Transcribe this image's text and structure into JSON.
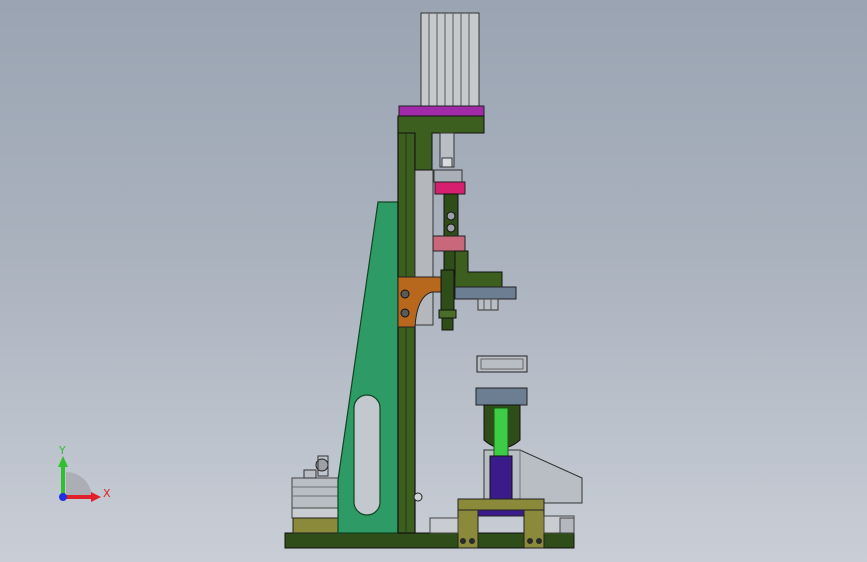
{
  "colors": {
    "background_top": "#9aa4b2",
    "background_bottom": "#c9ced6",
    "frame_dark_green": "#2f4d18",
    "frame_green": "#3c5e1f",
    "gusset_green": "#2e9a66",
    "motor_gray": "#c6cacd",
    "magenta_plate": "#a02aa8",
    "pink_block": "#d61f6e",
    "rose_block": "#c8687a",
    "orange_bracket": "#b8681d",
    "olive_block": "#8a8a3a",
    "purple_part": "#3b1a8a",
    "light_green_part": "#3ecb46",
    "slate_part": "#6c7e92",
    "steel_part": "#b9bec5",
    "axis_x": "#e0202a",
    "axis_y": "#2fbf2f",
    "axis_z": "#2030e0"
  },
  "triad": {
    "x_label": "X",
    "y_label": "Y"
  }
}
